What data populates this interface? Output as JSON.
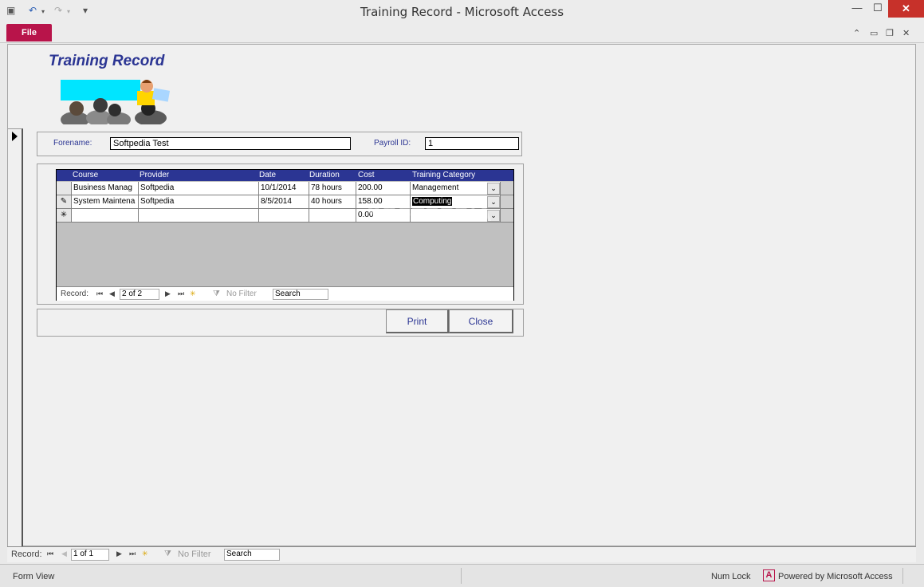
{
  "window": {
    "title": "Training Record  -  Microsoft Access"
  },
  "qat": {
    "undo": "↶",
    "redo": "↷",
    "customize": "▾"
  },
  "ribbon": {
    "file_tab": "File"
  },
  "form": {
    "title": "Training Record",
    "forename_label": "Forename:",
    "forename_value": "Softpedia Test",
    "payroll_label": "Payroll ID:",
    "payroll_value": "1",
    "columns": [
      "Course",
      "Provider",
      "Date",
      "Duration",
      "Cost",
      "Training Category"
    ],
    "rows": [
      {
        "course": "Business Manag",
        "provider": "Softpedia",
        "date": "10/1/2014",
        "duration": "78 hours",
        "cost": "200.00",
        "category": "Management",
        "selector": ""
      },
      {
        "course": "System Maintena",
        "provider": "Softpedia",
        "date": "8/5/2014",
        "duration": "40 hours",
        "cost": "158.00",
        "category": "Computing",
        "selector": "✎"
      },
      {
        "course": "",
        "provider": "",
        "date": "",
        "duration": "",
        "cost": "0.00",
        "category": "",
        "selector": "✳"
      }
    ],
    "sub_nav": {
      "record_label": "Record:",
      "position": "2 of 2",
      "filter": "No Filter",
      "search": "Search"
    },
    "print_label": "Print",
    "close_label": "Close"
  },
  "main_nav": {
    "record_label": "Record:",
    "position": "1 of 1",
    "filter": "No Filter",
    "search": "Search"
  },
  "status": {
    "view": "Form View",
    "numlock": "Num Lock",
    "powered": "Powered by Microsoft Access"
  },
  "watermark": "SOFTPEDIA",
  "colors": {
    "accent": "#2b3593",
    "file_tab": "#b8144a",
    "close": "#c7312a"
  }
}
